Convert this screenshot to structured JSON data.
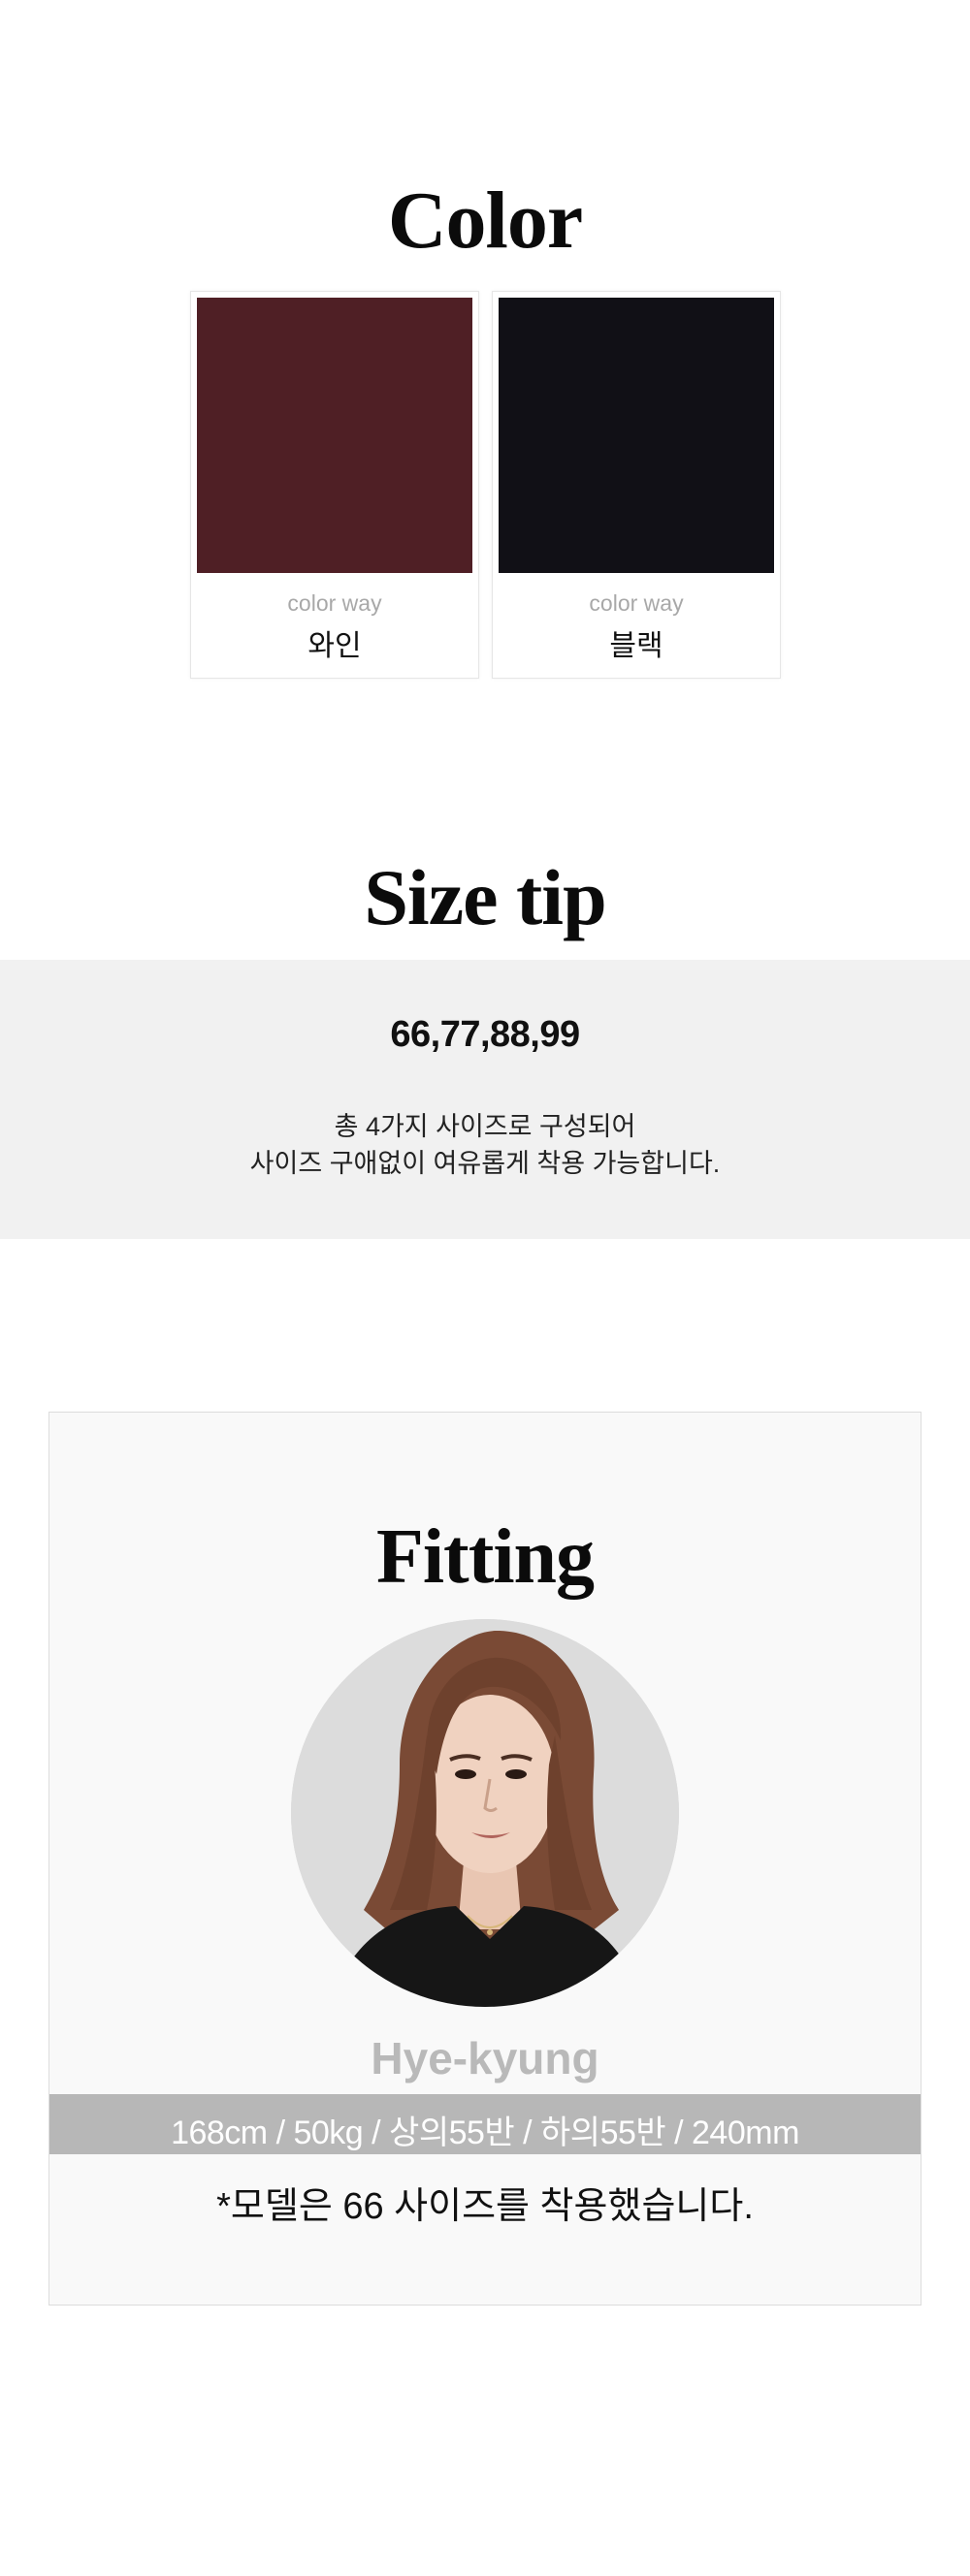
{
  "color_section": {
    "title": "Color",
    "swatches": [
      {
        "label": "color way",
        "name": "와인",
        "color": "#4f1f25"
      },
      {
        "label": "color way",
        "name": "블랙",
        "color": "#111016"
      }
    ]
  },
  "size_section": {
    "title": "Size tip",
    "sizes": "66,77,88,99",
    "desc_line1": "총 4가지 사이즈로 구성되어",
    "desc_line2": "사이즈 구애없이 여유롭게 착용 가능합니다."
  },
  "fitting_section": {
    "title": "Fitting",
    "model_name": "Hye-kyung",
    "model_stats": "168cm / 50kg / 상의55반 / 하의55반 / 240mm",
    "note": "*모델은 66 사이즈를 착용했습니다."
  },
  "colors": {
    "band_bg": "#f1f1f1",
    "stats_band": "#b7b7b7",
    "name_gray": "#b9b9b9"
  }
}
